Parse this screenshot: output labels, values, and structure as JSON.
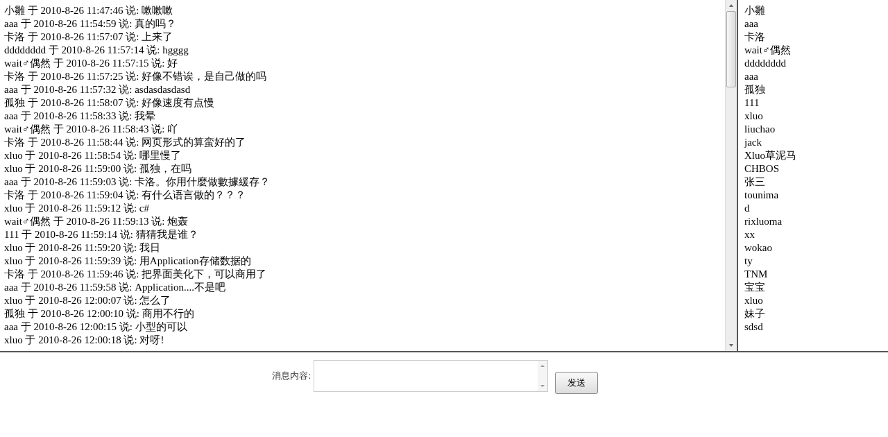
{
  "messages": [
    "小雛 于 2010-8-26 11:47:46 说: 嗽嗽嗽",
    "aaa 于 2010-8-26 11:54:59 说: 真的吗？",
    "卡洛 于 2010-8-26 11:57:07 说: 上来了",
    "dddddddd 于 2010-8-26 11:57:14 说: hgggg",
    "wait♂偶然 于 2010-8-26 11:57:15 说: 好",
    "卡洛 于 2010-8-26 11:57:25 说: 好像不错诶，是自己做的吗",
    "aaa 于 2010-8-26 11:57:32 说: asdasdasdasd",
    "孤独 于 2010-8-26 11:58:07 说: 好像速度有点慢",
    "aaa 于 2010-8-26 11:58:33 说: 我晕",
    "wait♂偶然 于 2010-8-26 11:58:43 说: 吖",
    "卡洛 于 2010-8-26 11:58:44 说: 网页形式的算蛮好的了",
    "xluo 于 2010-8-26 11:58:54 说: 哪里慢了",
    "xluo 于 2010-8-26 11:59:00 说: 孤独，在吗",
    "aaa 于 2010-8-26 11:59:03 说: 卡洛。你用什麼做數據緩存？",
    "卡洛 于 2010-8-26 11:59:04 说: 有什么语言做的？？？",
    "xluo 于 2010-8-26 11:59:12 说: c#",
    "wait♂偶然 于 2010-8-26 11:59:13 说: 炮轰",
    "111 于 2010-8-26 11:59:14 说: 猜猜我是谁？",
    "xluo 于 2010-8-26 11:59:20 说: 我日",
    "xluo 于 2010-8-26 11:59:39 说: 用Application存储数据的",
    "卡洛 于 2010-8-26 11:59:46 说: 把界面美化下，可以商用了",
    "aaa 于 2010-8-26 11:59:58 说: Application....不是吧",
    "xluo 于 2010-8-26 12:00:07 说: 怎么了",
    "孤独 于 2010-8-26 12:00:10 说: 商用不行的",
    "aaa 于 2010-8-26 12:00:15 说: 小型的可以",
    "xluo 于 2010-8-26 12:00:18 说: 对呀!"
  ],
  "users": [
    "小雛",
    "aaa",
    "卡洛",
    "wait♂偶然",
    "dddddddd",
    "aaa",
    "孤独",
    "111",
    "xluo",
    "liuchao",
    "jack",
    "Xluo草泥马",
    "CHBOS",
    "张三",
    "tounima",
    "d",
    "rixluoma",
    "xx",
    "wokao",
    "ty",
    "TNM",
    "宝宝",
    "xluo",
    "妹子",
    "sdsd"
  ],
  "composer": {
    "label": "消息内容:",
    "send_button": "发送"
  }
}
